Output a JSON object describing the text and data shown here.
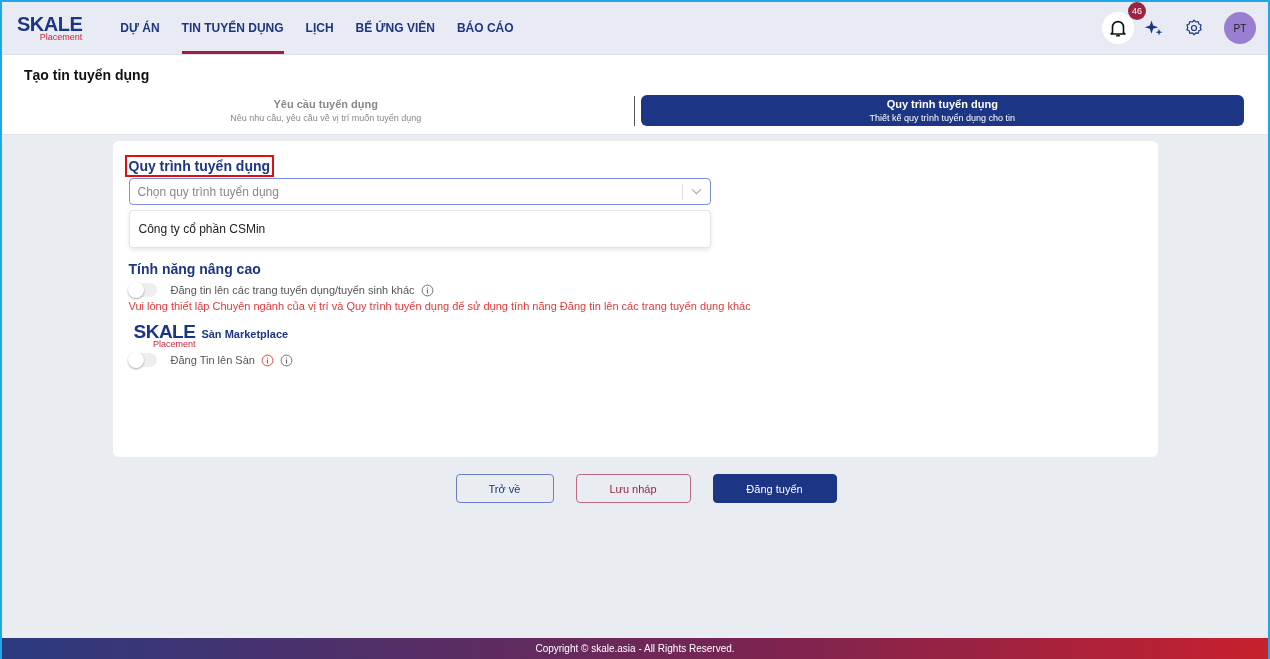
{
  "logo": {
    "name": "SKALE",
    "sub": "Placement"
  },
  "nav": [
    {
      "label": "DỰ ÁN",
      "selected": false
    },
    {
      "label": "TIN TUYỂN DỤNG",
      "selected": true
    },
    {
      "label": "LỊCH",
      "selected": false
    },
    {
      "label": "BỂ ỨNG VIÊN",
      "selected": false
    },
    {
      "label": "BÁO CÁO",
      "selected": false
    }
  ],
  "notifications": {
    "count": "46"
  },
  "avatar": "PT",
  "page_title": "Tạo tin tuyển dụng",
  "steps": [
    {
      "title": "Yêu cầu tuyển dụng",
      "subtitle": "Nêu nhu cầu, yêu cầu về vị trí muốn tuyển dụng",
      "selected": false
    },
    {
      "title": "Quy trình tuyển dụng",
      "subtitle": "Thiết kế quy trình tuyển dụng cho tin",
      "selected": true
    }
  ],
  "process": {
    "label": "Quy trình tuyển dụng",
    "highlighted": true,
    "placeholder": "Chọn quy trình tuyển dụng",
    "options": [
      "Công ty cổ phần CSMin"
    ]
  },
  "advanced": {
    "title": "Tính năng nâng cao",
    "toggle": {
      "label": "Đăng tin lên các trang tuyển dụng/tuyển sinh khác",
      "on": false
    },
    "warning": "Vui lòng thiết lập Chuyên ngành của vị trí và Quy trình tuyển dụng để sử dụng tính năng Đăng tin lên các trang tuyển dụng khác",
    "marketplace_logo": {
      "name": "SKALE",
      "sub": "Placement"
    },
    "marketplace_title": "Sàn Marketplace",
    "marketplace_toggle": {
      "label": "Đăng Tin lên Sàn",
      "on": false
    }
  },
  "buttons": [
    {
      "label": "Trở về",
      "kind": "back"
    },
    {
      "label": "Lưu nháp",
      "kind": "draft"
    },
    {
      "label": "Đăng tuyển",
      "kind": "primary"
    }
  ],
  "footer": "Copyright © skale.asia - All Rights Reserved."
}
